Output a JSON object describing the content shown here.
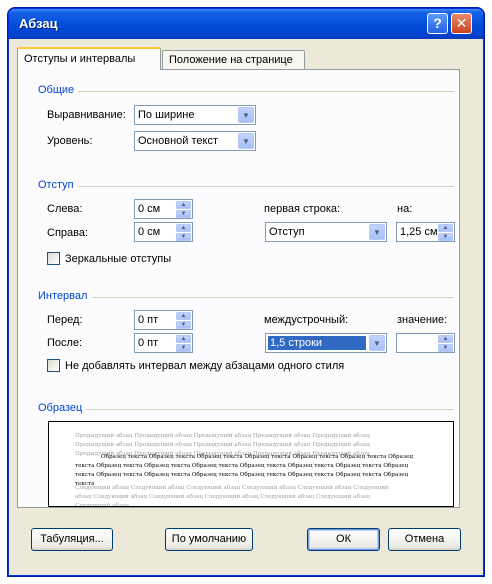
{
  "window": {
    "title": "Абзац",
    "help_glyph": "?",
    "close_glyph": "✕"
  },
  "tabs": [
    {
      "label": "Отступы и интервалы",
      "active": true
    },
    {
      "label": "Положение на странице",
      "active": false
    }
  ],
  "general": {
    "title": "Общие",
    "alignment_label": "Выравнивание:",
    "alignment_value": "По ширине",
    "level_label": "Уровень:",
    "level_value": "Основной текст"
  },
  "indent": {
    "title": "Отступ",
    "left_label": "Слева:",
    "left_value": "0 см",
    "right_label": "Справа:",
    "right_value": "0 см",
    "first_line_label": "первая строка:",
    "first_line_value": "Отступ",
    "by_label": "на:",
    "by_value": "1,25 см",
    "mirror_label": "Зеркальные отступы",
    "mirror_checked": false
  },
  "spacing": {
    "title": "Интервал",
    "before_label": "Перед:",
    "before_value": "0 пт",
    "after_label": "После:",
    "after_value": "0 пт",
    "line_label": "междустрочный:",
    "line_value": "1,5 строки",
    "value_label": "значение:",
    "value_value": "",
    "no_space_label": "Не добавлять интервал между абзацами одного стиля",
    "no_space_checked": false
  },
  "sample": {
    "title": "Образец",
    "prev_text": "Предыдущий абзац Предыдущий абзац Предыдущий абзац Предыдущий абзац Предыдущий абзац Предыдущий абзац Предыдущий абзац Предыдущий абзац Предыдущий абзац Предыдущий абзац Предыдущий абзац Предыдущий абзац Предыдущий абзац Предыдущий абзац Предыдущий абзац",
    "sample_text": "Образец текста Образец текста Образец текста Образец текста Образец текста Образец текста Образец текста Образец текста Образец текста Образец текста Образец текста Образец текста Образец текста Образец текста Образец текста Образец текста Образец текста Образец текста Образец текста Образец текста Образец текста",
    "next_text": "Следующий абзац Следующий абзац Следующий абзац Следующий абзац Следующий абзац Следующий абзац Следующий абзац Следующий абзац Следующий абзац Следующий абзац Следующий абзац Следующий абзац"
  },
  "buttons": {
    "tabs": "Табуляция...",
    "default": "По умолчанию",
    "ok": "ОК",
    "cancel": "Отмена"
  },
  "colors": {
    "titlebar": "#0450d8",
    "dialog_bg": "#ece9d8",
    "group_title": "#0046d5",
    "selection": "#316ac5"
  }
}
